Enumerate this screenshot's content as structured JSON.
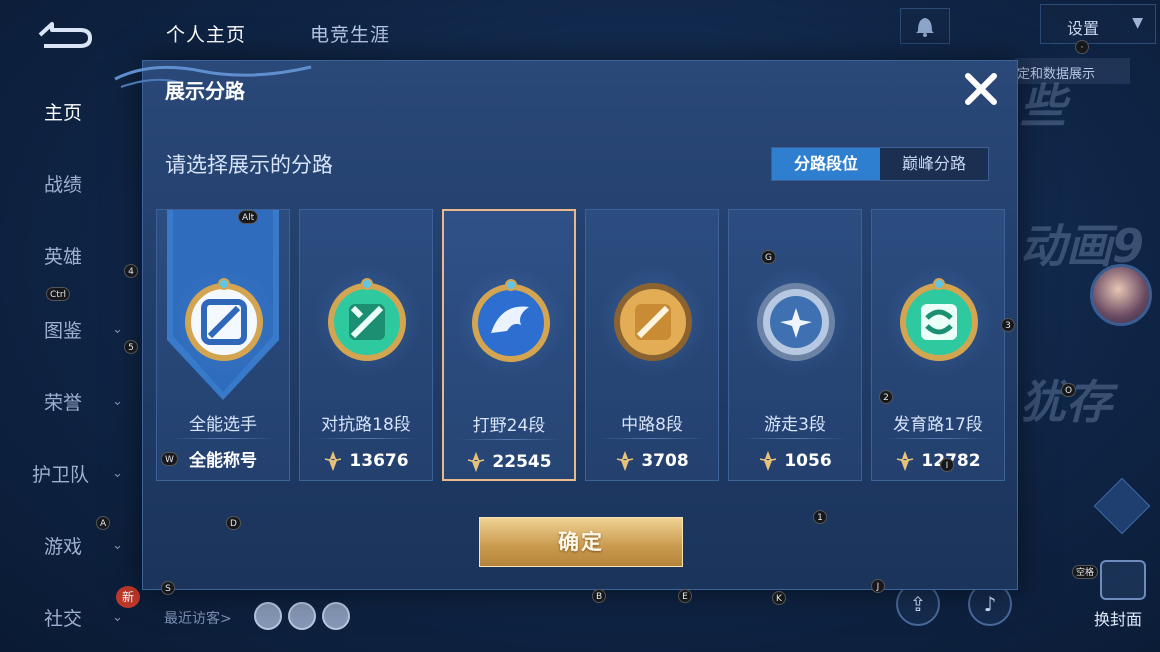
{
  "topbar": {
    "tabs": [
      {
        "label": "个人主页",
        "active": true
      },
      {
        "label": "电竞生涯",
        "active": false
      }
    ],
    "settings_label": "设置",
    "banner_text": "定和数据展示"
  },
  "sidebar": {
    "items": [
      {
        "label": "主页",
        "active": true,
        "chevron": false
      },
      {
        "label": "战绩",
        "active": false,
        "chevron": false
      },
      {
        "label": "英雄",
        "active": false,
        "chevron": false
      },
      {
        "label": "图鉴",
        "active": false,
        "chevron": true
      },
      {
        "label": "荣誉",
        "active": false,
        "chevron": true
      },
      {
        "label": "护卫队",
        "active": false,
        "chevron": true
      },
      {
        "label": "游戏",
        "active": false,
        "chevron": true
      },
      {
        "label": "社交",
        "active": false,
        "chevron": true
      }
    ],
    "new_badge": "新"
  },
  "background": {
    "chars": [
      "些",
      "动画9",
      "犹存"
    ],
    "visitors_label": "最近访客>",
    "change_cover_label": "换封面"
  },
  "dialog": {
    "title": "展示分路",
    "subtitle": "请选择展示的分路",
    "segments": [
      {
        "label": "分路段位",
        "active": true
      },
      {
        "label": "巅峰分路",
        "active": false
      }
    ],
    "cards": [
      {
        "label": "全能选手",
        "footer": "全能称号",
        "footer_type": "title",
        "selected": false,
        "emblem": "versatile-emblem-icon",
        "color": "#3b7fd4"
      },
      {
        "label": "对抗路18段",
        "footer": "13676",
        "footer_type": "score",
        "selected": false,
        "emblem": "clash-lane-emblem-icon",
        "color": "#2fc9a0"
      },
      {
        "label": "打野24段",
        "footer": "22545",
        "footer_type": "score",
        "selected": true,
        "emblem": "jungle-emblem-icon",
        "color": "#2d6fd0"
      },
      {
        "label": "中路8段",
        "footer": "3708",
        "footer_type": "score",
        "selected": false,
        "emblem": "mid-lane-emblem-icon",
        "color": "#d9a24a"
      },
      {
        "label": "游走3段",
        "footer": "1056",
        "footer_type": "score",
        "selected": false,
        "emblem": "roam-emblem-icon",
        "color": "#9fb6d6"
      },
      {
        "label": "发育路17段",
        "footer": "12782",
        "footer_type": "score",
        "selected": false,
        "emblem": "farm-lane-emblem-icon",
        "color": "#2fc9a0"
      }
    ],
    "confirm_label": "确定"
  },
  "key_hints": [
    "Alt",
    "4",
    "Ctrl",
    "5",
    "W",
    "A",
    "D",
    "S",
    "G",
    "3",
    "2",
    "O",
    "I",
    "1",
    "B",
    "E",
    "K",
    "J",
    "空格",
    "·"
  ]
}
